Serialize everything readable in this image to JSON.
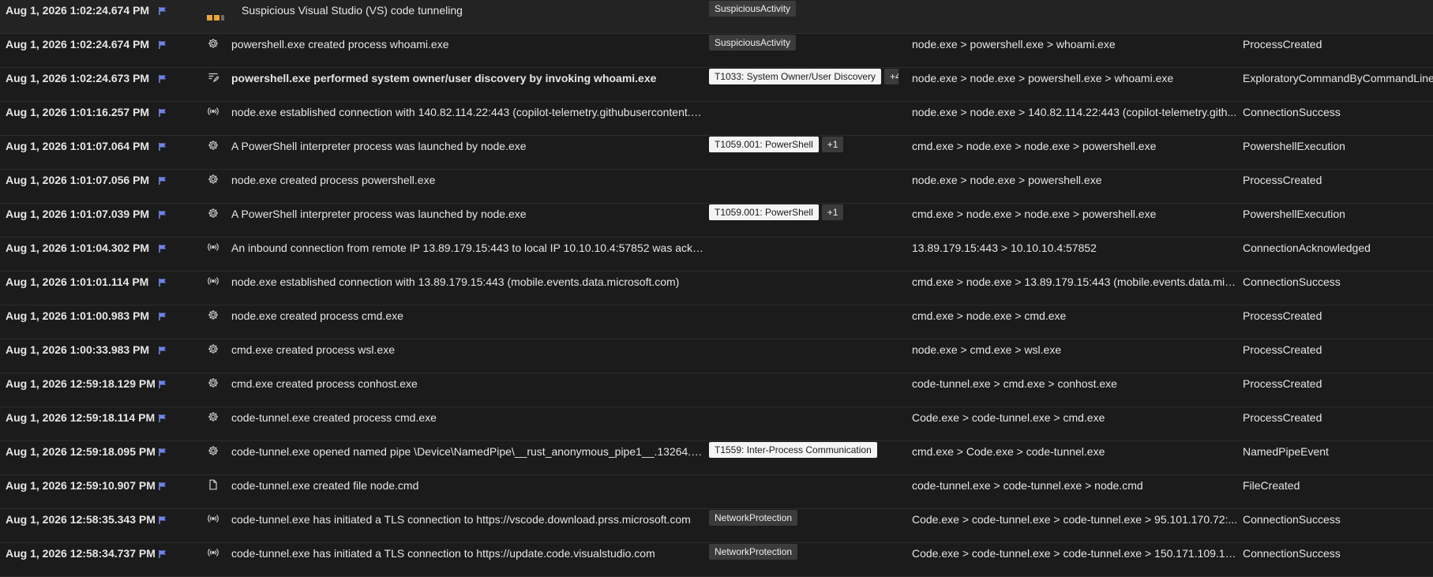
{
  "colors": {
    "background": "#1b1b1b",
    "flag": "#6f83e8",
    "severity_filled": "#e8a33d",
    "severity_empty": "#6b6b6b"
  },
  "rows": [
    {
      "time": "Aug 1, 2026 1:02:24.674 PM",
      "icon": "severity-icon",
      "title": "Suspicious Visual Studio (VS) code tunneling",
      "bold": false,
      "tags": [
        {
          "label": "SuspiciousActivity",
          "style": "dark"
        }
      ],
      "more": "",
      "chain": "",
      "type": ""
    },
    {
      "time": "Aug 1, 2026 1:02:24.674 PM",
      "icon": "gear-icon",
      "title": "powershell.exe created process whoami.exe",
      "bold": false,
      "tags": [
        {
          "label": "SuspiciousActivity",
          "style": "dark"
        }
      ],
      "more": "",
      "chain": "node.exe > powershell.exe > whoami.exe",
      "type": "ProcessCreated"
    },
    {
      "time": "Aug 1, 2026 1:02:24.673 PM",
      "icon": "command-icon",
      "title": "powershell.exe performed system owner/user discovery by invoking whoami.exe",
      "bold": true,
      "tags": [
        {
          "label": "T1033: System Owner/User Discovery",
          "style": "light"
        }
      ],
      "more": "+4",
      "chain": "node.exe > node.exe > powershell.exe > whoami.exe",
      "type": "ExploratoryCommandByCommandLine"
    },
    {
      "time": "Aug 1, 2026 1:01:16.257 PM",
      "icon": "network-icon",
      "title": "node.exe established connection with 140.82.114.22:443 (copilot-telemetry.githubusercontent.c...",
      "bold": false,
      "tags": [],
      "more": "",
      "chain": "node.exe > node.exe > 140.82.114.22:443 (copilot-telemetry.gith...",
      "type": "ConnectionSuccess"
    },
    {
      "time": "Aug 1, 2026 1:01:07.064 PM",
      "icon": "gear-icon",
      "title": "A PowerShell interpreter process was launched by node.exe",
      "bold": false,
      "tags": [
        {
          "label": "T1059.001: PowerShell",
          "style": "light"
        }
      ],
      "more": "+1",
      "chain": "cmd.exe > node.exe > node.exe > powershell.exe",
      "type": "PowershellExecution"
    },
    {
      "time": "Aug 1, 2026 1:01:07.056 PM",
      "icon": "gear-icon",
      "title": "node.exe created process powershell.exe",
      "bold": false,
      "tags": [],
      "more": "",
      "chain": "node.exe > node.exe > powershell.exe",
      "type": "ProcessCreated"
    },
    {
      "time": "Aug 1, 2026 1:01:07.039 PM",
      "icon": "gear-icon",
      "title": "A PowerShell interpreter process was launched by node.exe",
      "bold": false,
      "tags": [
        {
          "label": "T1059.001: PowerShell",
          "style": "light"
        }
      ],
      "more": "+1",
      "chain": "cmd.exe > node.exe > node.exe > powershell.exe",
      "type": "PowershellExecution"
    },
    {
      "time": "Aug 1, 2026 1:01:04.302 PM",
      "icon": "network-icon",
      "title": "An inbound connection from remote IP 13.89.179.15:443 to local IP 10.10.10.4:57852 was ackno...",
      "bold": false,
      "tags": [],
      "more": "",
      "chain": "13.89.179.15:443 > 10.10.10.4:57852",
      "type": "ConnectionAcknowledged"
    },
    {
      "time": "Aug 1, 2026 1:01:01.114 PM",
      "icon": "network-icon",
      "title": "node.exe established connection with 13.89.179.15:443 (mobile.events.data.microsoft.com)",
      "bold": false,
      "tags": [],
      "more": "",
      "chain": "cmd.exe > node.exe > 13.89.179.15:443 (mobile.events.data.micr...",
      "type": "ConnectionSuccess"
    },
    {
      "time": "Aug 1, 2026 1:01:00.983 PM",
      "icon": "gear-icon",
      "title": "node.exe created process cmd.exe",
      "bold": false,
      "tags": [],
      "more": "",
      "chain": "cmd.exe > node.exe > cmd.exe",
      "type": "ProcessCreated"
    },
    {
      "time": "Aug 1, 2026 1:00:33.983 PM",
      "icon": "gear-icon",
      "title": "cmd.exe created process wsl.exe",
      "bold": false,
      "tags": [],
      "more": "",
      "chain": "node.exe > cmd.exe > wsl.exe",
      "type": "ProcessCreated"
    },
    {
      "time": "Aug 1, 2026 12:59:18.129 PM",
      "icon": "gear-icon",
      "title": "cmd.exe created process conhost.exe",
      "bold": false,
      "tags": [],
      "more": "",
      "chain": "code-tunnel.exe > cmd.exe > conhost.exe",
      "type": "ProcessCreated"
    },
    {
      "time": "Aug 1, 2026 12:59:18.114 PM",
      "icon": "gear-icon",
      "title": "code-tunnel.exe created process cmd.exe",
      "bold": false,
      "tags": [],
      "more": "",
      "chain": "Code.exe > code-tunnel.exe > cmd.exe",
      "type": "ProcessCreated"
    },
    {
      "time": "Aug 1, 2026 12:59:18.095 PM",
      "icon": "gear-icon",
      "title": "code-tunnel.exe opened named pipe \\Device\\NamedPipe\\__rust_anonymous_pipe1__.13264.26...",
      "bold": false,
      "tags": [
        {
          "label": "T1559: Inter-Process Communication",
          "style": "light"
        }
      ],
      "more": "",
      "chain": "cmd.exe > Code.exe > code-tunnel.exe",
      "type": "NamedPipeEvent"
    },
    {
      "time": "Aug 1, 2026 12:59:10.907 PM",
      "icon": "file-icon",
      "title": "code-tunnel.exe created file node.cmd",
      "bold": false,
      "tags": [],
      "more": "",
      "chain": "code-tunnel.exe > code-tunnel.exe > node.cmd",
      "type": "FileCreated"
    },
    {
      "time": "Aug 1, 2026 12:58:35.343 PM",
      "icon": "network-icon",
      "title": "code-tunnel.exe has initiated a TLS connection to https://vscode.download.prss.microsoft.com",
      "bold": false,
      "tags": [
        {
          "label": "NetworkProtection",
          "style": "dark"
        }
      ],
      "more": "",
      "chain": "Code.exe > code-tunnel.exe > code-tunnel.exe > 95.101.170.72:...",
      "type": "ConnectionSuccess"
    },
    {
      "time": "Aug 1, 2026 12:58:34.737 PM",
      "icon": "network-icon",
      "title": "code-tunnel.exe has initiated a TLS connection to https://update.code.visualstudio.com",
      "bold": false,
      "tags": [
        {
          "label": "NetworkProtection",
          "style": "dark"
        }
      ],
      "more": "",
      "chain": "Code.exe > code-tunnel.exe > code-tunnel.exe > 150.171.109.10...",
      "type": "ConnectionSuccess"
    }
  ]
}
